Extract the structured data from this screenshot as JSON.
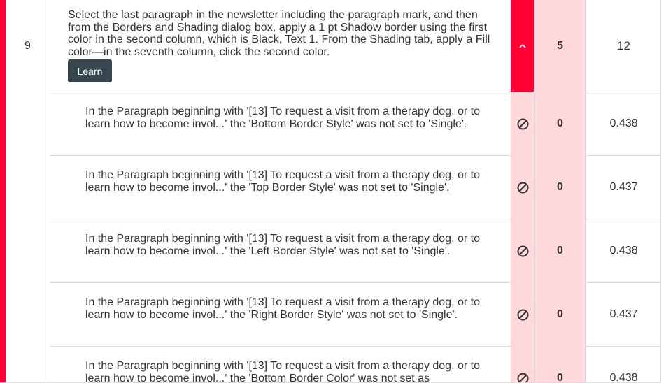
{
  "colors": {
    "accent": "#ff0033",
    "score_bg": "#ffd9dc",
    "learn_button": "#37474f"
  },
  "task": {
    "number": "9",
    "description": "Select the last paragraph in the newsletter including the paragraph mark, and then from the Borders and Shading dialog box, apply a 1 pt Shadow border using the first color in the second column, which is Black, Text 1. From the Shading tab, apply a Fill color—in the seventh column, click the second color.",
    "learn_label": "Learn",
    "toggle_icon": "chevron-up-icon",
    "score": "5",
    "total": "12"
  },
  "subtasks": [
    {
      "message": "In the Paragraph beginning with '[13] To request a visit from a therapy dog, or to learn how to become invol...' the 'Bottom Border Style' was not set to 'Single'.",
      "status_icon": "prohibited-icon",
      "score": "0",
      "weight": "0.438"
    },
    {
      "message": "In the Paragraph beginning with '[13] To request a visit from a therapy dog, or to learn how to become invol...' the 'Top Border Style' was not set to 'Single'.",
      "status_icon": "prohibited-icon",
      "score": "0",
      "weight": "0.437"
    },
    {
      "message": "In the Paragraph beginning with '[13] To request a visit from a therapy dog, or to learn how to become invol...' the 'Left Border Style' was not set to 'Single'.",
      "status_icon": "prohibited-icon",
      "score": "0",
      "weight": "0.438"
    },
    {
      "message": "In the Paragraph beginning with '[13] To request a visit from a therapy dog, or to learn how to become invol...' the 'Right Border Style' was not set to 'Single'.",
      "status_icon": "prohibited-icon",
      "score": "0",
      "weight": "0.437"
    },
    {
      "message": "In the Paragraph beginning with '[13] To request a visit from a therapy dog, or to learn how to become invol...' the 'Bottom Border Color' was not set as",
      "status_icon": "prohibited-icon",
      "score": "0",
      "weight": "0.438"
    }
  ]
}
